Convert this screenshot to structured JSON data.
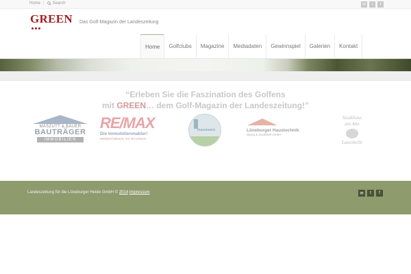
{
  "topbar": {
    "home_label": "Home",
    "search_label": "Search",
    "social": [
      "mail-icon",
      "twitter-icon",
      "facebook-icon"
    ]
  },
  "header": {
    "logo_text": "GREEN",
    "tagline": "Das Golf-Magazin der Landeszeitung"
  },
  "nav": {
    "items": [
      "Home",
      "Golfclubs",
      "Magazine",
      "Mediadaten",
      "Gewinnspiel",
      "Galerien",
      "Kontakt"
    ],
    "active": "Home"
  },
  "headline": {
    "line1": "“Erleben Sie die Faszination des Golfens",
    "line2_pre": "mit ",
    "line2_brand": "GREEN",
    "line2_post": "… dem Golf-Magazin der Landeszeitung!”"
  },
  "partners": {
    "p1": {
      "name": "MASZUTT & BAUER",
      "big": "BAUTRÄGER",
      "bar": "IMMOBILIEN"
    },
    "p2": {
      "mark": "RE/MAX",
      "sub": "Die Immobilienmakler!",
      "sub2": "Weltweit bekannt. Vor Ort präsent"
    },
    "p3": {
      "text": "massmann"
    },
    "p4": {
      "t1": "Lüneburger Haustechnik",
      "t2": "Sparg & Quollstelt GmbH"
    },
    "p5": {
      "t1": "Steakhaus",
      "t2": "am Alte",
      "t3": "Lasenkelle"
    }
  },
  "footer": {
    "copy_text": "Landeszeitung für die Lüneburger Heide GmbH © ",
    "year_link": "2014",
    "impressum": "Impressum",
    "social": [
      "mail-icon",
      "twitter-icon",
      "facebook-icon"
    ]
  },
  "colors": {
    "brand_red": "#a31c22",
    "footer_green": "#8d9b6d",
    "nav_active_border": "#a6b88c"
  }
}
